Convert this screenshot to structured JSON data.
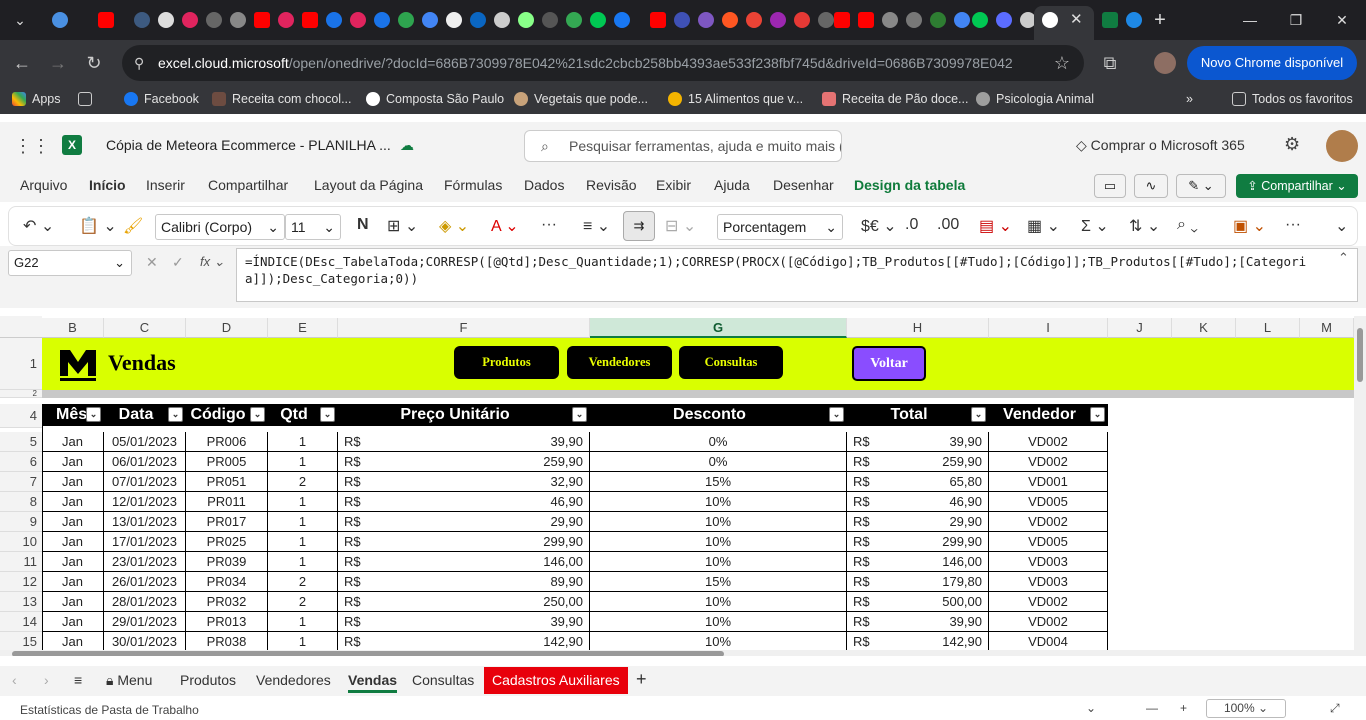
{
  "browser": {
    "url_host": "excel.cloud.microsoft",
    "url_path": "/open/onedrive/?docId=686B7309978E042%21sdc2cbcb258bb4393ae533f238fbf745d&driveId=0686B7309978E042",
    "new_chrome_label": "Novo Chrome disponível",
    "window_controls": [
      "minimize-icon",
      "restore-icon",
      "close-icon"
    ]
  },
  "bookmarks": {
    "apps_label": "Apps",
    "items": [
      "Facebook",
      "Receita com chocol...",
      "Composta São Paulo",
      "Vegetais que pode...",
      "15 Alimentos que v...",
      "Receita de Pão doce...",
      "Psicologia Animal"
    ],
    "all_favorites": "Todos os favoritos"
  },
  "excel": {
    "doc_title": "Cópia de Meteora Ecommerce - PLANILHA ...",
    "search_placeholder": "Pesquisar ferramentas, ajuda e muito mais (Alt + Q)",
    "buy_label": "Comprar o Microsoft 365",
    "share_label": "Compartilhar",
    "menu": [
      "Arquivo",
      "Início",
      "Inserir",
      "Compartilhar",
      "Layout da Página",
      "Fórmulas",
      "Dados",
      "Revisão",
      "Exibir",
      "Ajuda",
      "Desenhar",
      "Design da tabela"
    ],
    "font_name": "Calibri (Corpo)",
    "font_size": "11",
    "number_format": "Porcentagem",
    "name_box": "G22",
    "formula": "=ÍNDICE(DEsc_TabelaToda;CORRESP([@Qtd];Desc_Quantidade;1);CORRESP(PROCX([@Código];TB_Produtos[[#Tudo];[Código]];TB_Produtos[[#Tudo];[Categoria]]);Desc_Categoria;0))"
  },
  "grid": {
    "columns": [
      "B",
      "C",
      "D",
      "E",
      "F",
      "G",
      "H",
      "I",
      "J",
      "K",
      "L",
      "M"
    ],
    "selected_column": "G",
    "row_numbers": [
      "1",
      "2",
      "4",
      "5",
      "6",
      "7",
      "8",
      "9",
      "10",
      "11",
      "12",
      "13",
      "14",
      "15"
    ],
    "sheet_title": "Vendas",
    "nav_buttons": [
      "Produtos",
      "Vendedores",
      "Consultas"
    ],
    "back_button": "Voltar",
    "table_headers": [
      "Mês",
      "Data",
      "Código",
      "Qtd",
      "Preço Unitário",
      "Desconto",
      "Total",
      "Vendedor"
    ],
    "currency": "R$",
    "rows": [
      [
        "Jan",
        "05/01/2023",
        "PR006",
        "1",
        "39,90",
        "0%",
        "39,90",
        "VD002"
      ],
      [
        "Jan",
        "06/01/2023",
        "PR005",
        "1",
        "259,90",
        "0%",
        "259,90",
        "VD002"
      ],
      [
        "Jan",
        "07/01/2023",
        "PR051",
        "2",
        "32,90",
        "15%",
        "65,80",
        "VD001"
      ],
      [
        "Jan",
        "12/01/2023",
        "PR011",
        "1",
        "46,90",
        "10%",
        "46,90",
        "VD005"
      ],
      [
        "Jan",
        "13/01/2023",
        "PR017",
        "1",
        "29,90",
        "10%",
        "29,90",
        "VD002"
      ],
      [
        "Jan",
        "17/01/2023",
        "PR025",
        "1",
        "299,90",
        "10%",
        "299,90",
        "VD005"
      ],
      [
        "Jan",
        "23/01/2023",
        "PR039",
        "1",
        "146,00",
        "10%",
        "146,00",
        "VD003"
      ],
      [
        "Jan",
        "26/01/2023",
        "PR034",
        "2",
        "89,90",
        "15%",
        "179,80",
        "VD003"
      ],
      [
        "Jan",
        "28/01/2023",
        "PR032",
        "2",
        "250,00",
        "10%",
        "500,00",
        "VD002"
      ],
      [
        "Jan",
        "29/01/2023",
        "PR013",
        "1",
        "39,90",
        "10%",
        "39,90",
        "VD002"
      ],
      [
        "Jan",
        "30/01/2023",
        "PR038",
        "1",
        "142,90",
        "10%",
        "142,90",
        "VD004"
      ]
    ]
  },
  "sheets": {
    "menu_label": "Menu",
    "tabs": [
      "Produtos",
      "Vendedores",
      "Vendas",
      "Consultas",
      "Cadastros Auxiliares"
    ],
    "active": "Vendas"
  },
  "status": {
    "left": "Estatísticas de Pasta de Trabalho",
    "zoom": "100%"
  },
  "colors": {
    "accent_lime": "#d9ff00",
    "excel_green": "#107c41",
    "back_purple": "#8a4dff",
    "red_tab": "#e8000b"
  }
}
